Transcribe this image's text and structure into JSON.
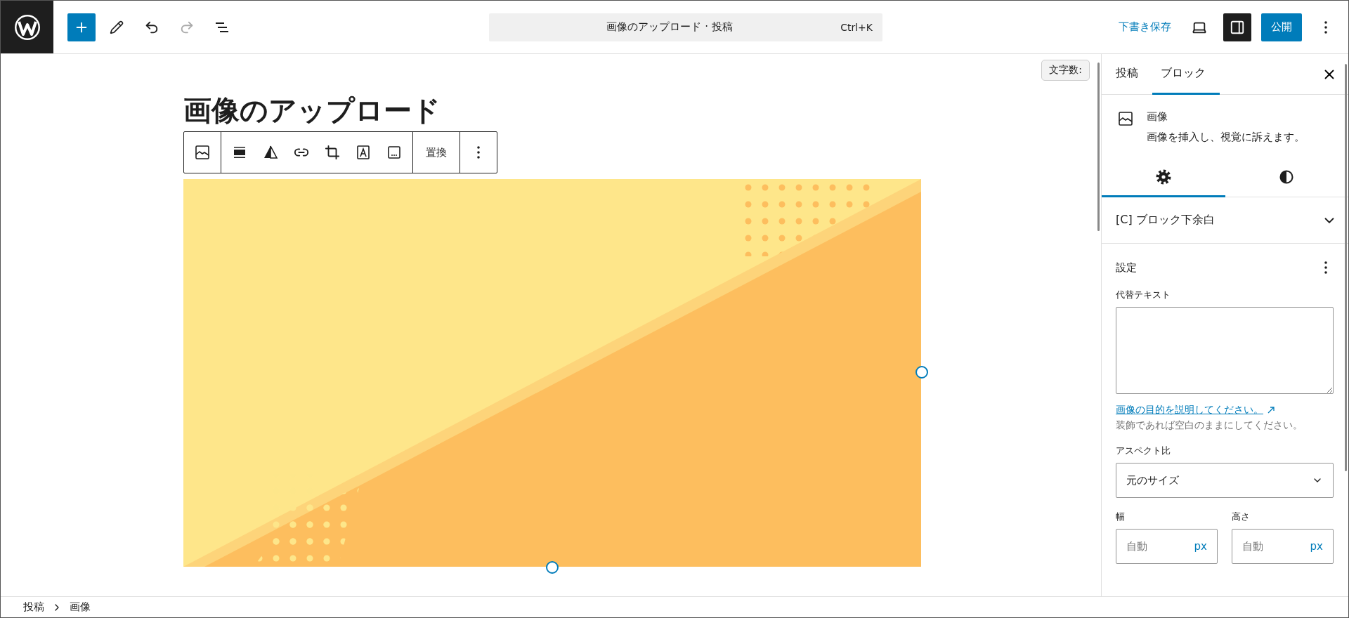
{
  "topbar": {
    "undo": {
      "disabled": false
    },
    "redo": {
      "disabled": true
    },
    "command_bar": {
      "title": "画像のアップロード · 投稿",
      "shortcut": "Ctrl+K"
    },
    "save_draft": "下書き保存",
    "settings_toggle": {
      "pressed": true
    },
    "publish": "公開"
  },
  "editor": {
    "word_count": "文字数:",
    "title": "画像のアップロード",
    "block_toolbar": {
      "replace": "置換"
    },
    "image": {
      "kind": "picture",
      "selected": true
    }
  },
  "sidebar": {
    "tabs": [
      {
        "label": "投稿",
        "selected": false
      },
      {
        "label": "ブロック",
        "selected": true
      }
    ],
    "block": {
      "name": "画像",
      "description": "画像を挿入し、視覚に訴えます。"
    },
    "style_tabs": [
      {
        "kind": "settings",
        "selected": true
      },
      {
        "kind": "styles",
        "selected": false
      }
    ],
    "panels": [
      {
        "title": "[C] ブロック下余白",
        "expanded": false
      }
    ],
    "settings": {
      "title": "設定",
      "alt_label": "代替テキスト",
      "alt_link": "画像の目的を説明してください。",
      "alt_help": "装飾であれば空白のままにしてください。",
      "aspect_label": "アスペクト比",
      "aspect_value": "元のサイズ",
      "width_label": "幅",
      "width_placeholder": "自動",
      "width_unit": "px",
      "height_label": "高さ",
      "height_placeholder": "自動",
      "height_unit": "px"
    }
  },
  "breadcrumb": [
    "投稿",
    "画像"
  ]
}
